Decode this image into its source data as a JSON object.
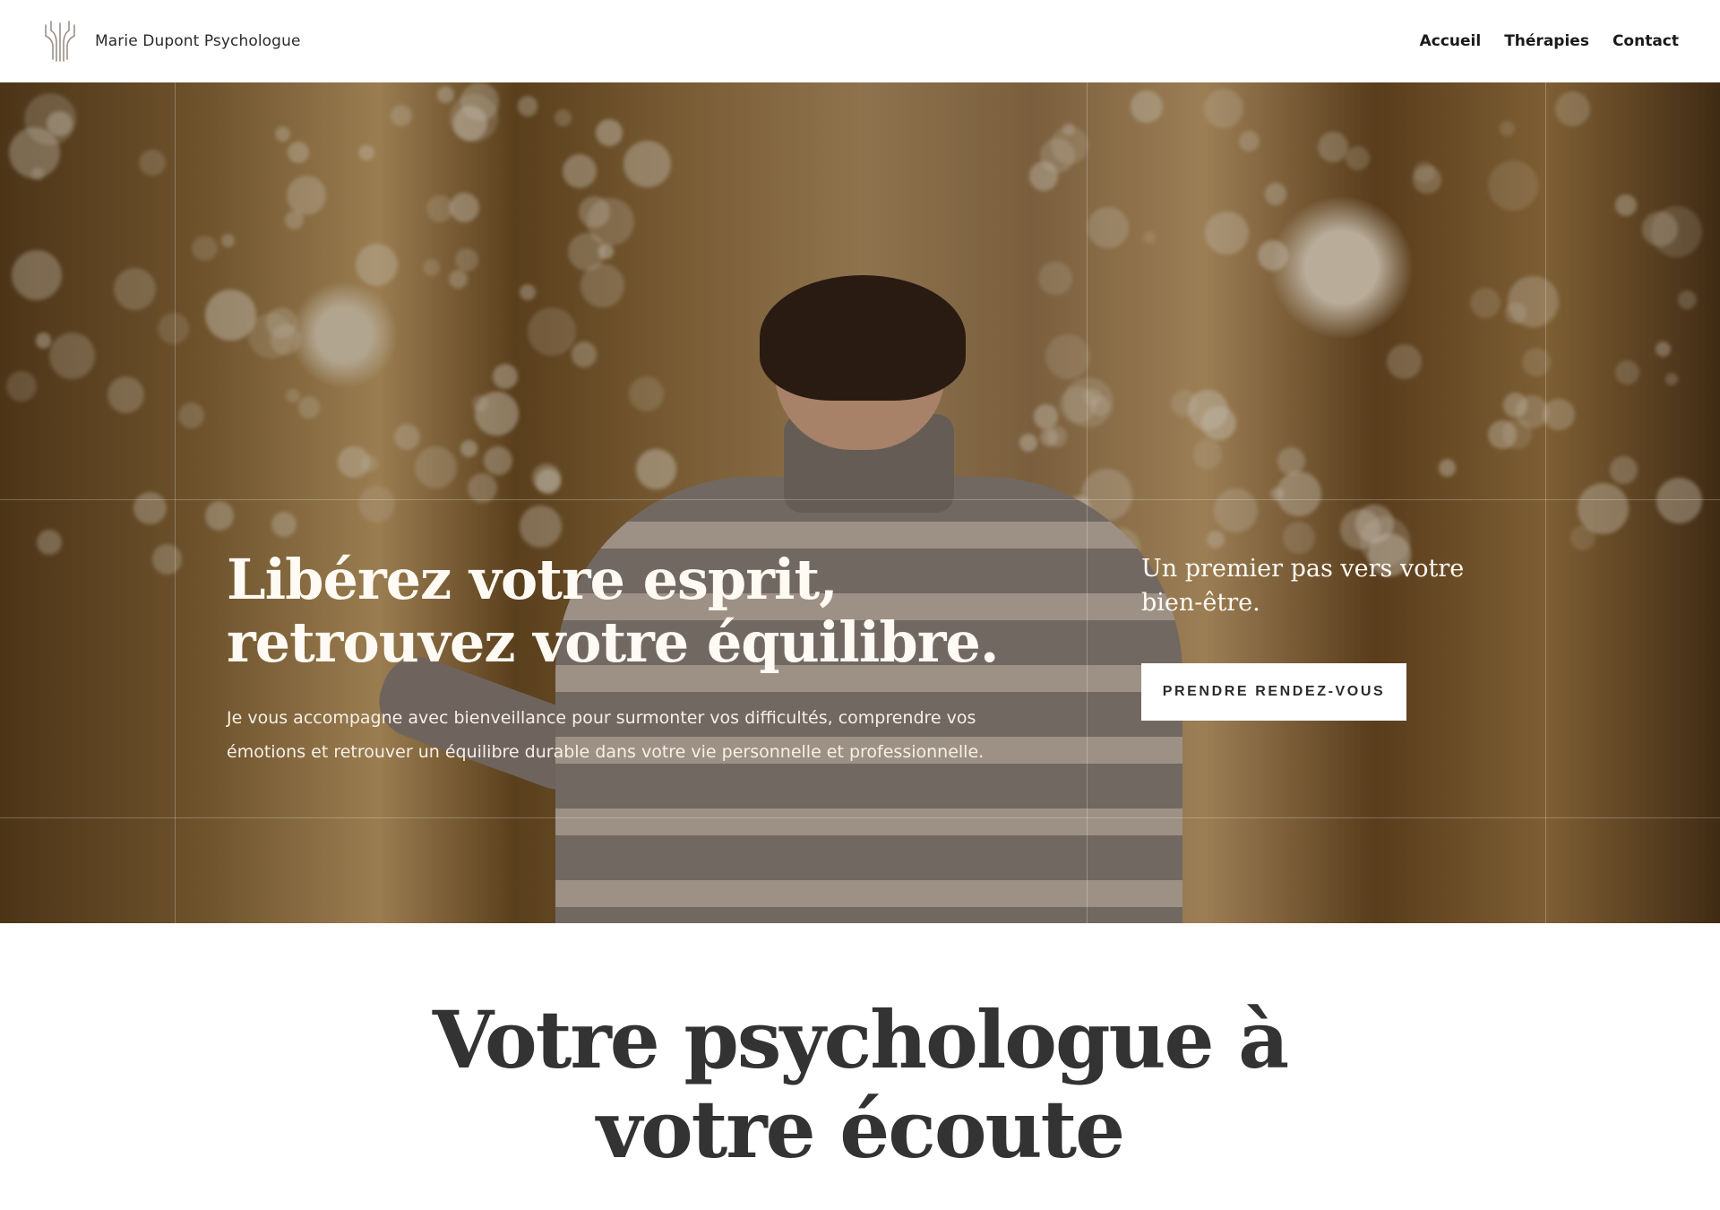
{
  "header": {
    "brand_name": "Marie Dupont Psychologue",
    "logo_icon": "tree-roots-logo-icon",
    "nav": [
      {
        "label": "Accueil"
      },
      {
        "label": "Thérapies"
      },
      {
        "label": "Contact"
      }
    ]
  },
  "hero": {
    "title": "Libérez votre esprit, retrouvez votre équilibre.",
    "description": "Je vous accompagne avec bienveillance pour surmonter vos difficultés, comprendre vos émotions et retrouver un équilibre durable dans votre vie personnelle et professionnelle.",
    "side_text": "Un premier pas vers votre bien-être.",
    "cta_label": "PRENDRE RENDEZ-VOUS",
    "photo": "woman-smiling-autumn-leaves-forest"
  },
  "section": {
    "title": "Votre psychologue à votre écoute"
  },
  "colors": {
    "background": "#ffffff",
    "text_dark": "#333333",
    "hero_text": "#fffaf3",
    "button_bg": "#ffffff"
  }
}
